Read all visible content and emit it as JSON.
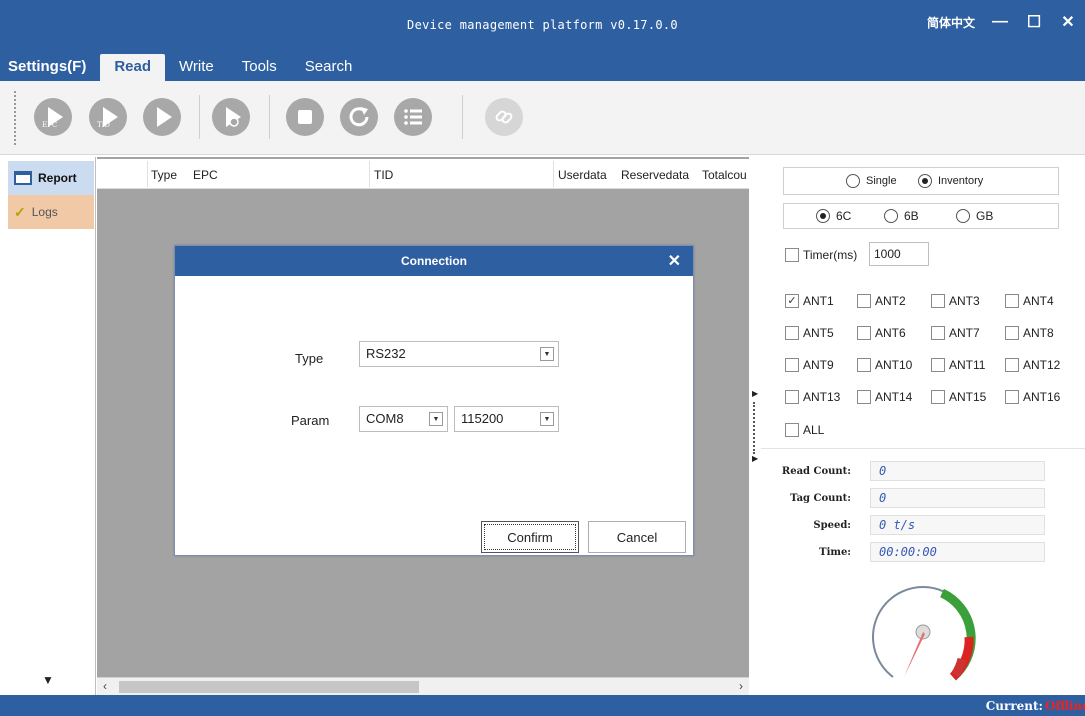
{
  "window": {
    "title": "Device management platform v0.17.0.0",
    "language": "简体中文",
    "minimize_icon": "minimize-icon",
    "maximize_icon": "maximize-icon",
    "close_icon": "close-icon"
  },
  "menu": {
    "tabs": [
      {
        "label": "Settings(F)"
      },
      {
        "label": "Read",
        "active": true
      },
      {
        "label": "Write"
      },
      {
        "label": "Tools"
      },
      {
        "label": "Search"
      }
    ]
  },
  "toolbar": {
    "buttons": [
      {
        "icon": "play-epc-icon",
        "sub": "EPC"
      },
      {
        "icon": "play-tid-icon",
        "sub": "TID"
      },
      {
        "icon": "play-icon"
      },
      {
        "icon": "play-data-icon"
      },
      {
        "icon": "stop-icon"
      },
      {
        "icon": "refresh-icon"
      },
      {
        "icon": "list-menu-icon"
      },
      {
        "icon": "link-icon"
      }
    ]
  },
  "sidebar": {
    "items": [
      {
        "label": "Report",
        "icon": "window-icon",
        "active": true
      },
      {
        "label": "Logs",
        "icon": "check-flag-icon"
      }
    ]
  },
  "table": {
    "columns": [
      "Type",
      "EPC",
      "TID",
      "Userdata",
      "Reservedata",
      "Totalcou"
    ]
  },
  "right_panel": {
    "mode_options": [
      {
        "label": "Single",
        "selected": false
      },
      {
        "label": "Inventory",
        "selected": true
      }
    ],
    "protocol_options": [
      {
        "label": "6C",
        "selected": true
      },
      {
        "label": "6B",
        "selected": false
      },
      {
        "label": "GB",
        "selected": false
      }
    ],
    "timer": {
      "label": "Timer(ms)",
      "checked": false,
      "value": "1000"
    },
    "antennas": [
      {
        "label": "ANT1",
        "checked": true
      },
      {
        "label": "ANT2",
        "checked": false
      },
      {
        "label": "ANT3",
        "checked": false
      },
      {
        "label": "ANT4",
        "checked": false
      },
      {
        "label": "ANT5",
        "checked": false
      },
      {
        "label": "ANT6",
        "checked": false
      },
      {
        "label": "ANT7",
        "checked": false
      },
      {
        "label": "ANT8",
        "checked": false
      },
      {
        "label": "ANT9",
        "checked": false
      },
      {
        "label": "ANT10",
        "checked": false
      },
      {
        "label": "ANT11",
        "checked": false
      },
      {
        "label": "ANT12",
        "checked": false
      },
      {
        "label": "ANT13",
        "checked": false
      },
      {
        "label": "ANT14",
        "checked": false
      },
      {
        "label": "ANT15",
        "checked": false
      },
      {
        "label": "ANT16",
        "checked": false
      }
    ],
    "all": {
      "label": "ALL",
      "checked": false
    },
    "stats": [
      {
        "label": "Read Count:",
        "value": "0"
      },
      {
        "label": "Tag Count:",
        "value": "0"
      },
      {
        "label": "Speed:",
        "value": "0  t/s"
      },
      {
        "label": "Time:",
        "value": "00:00:00"
      }
    ]
  },
  "status": {
    "current_label": "Current:",
    "current_value": "Offline",
    "current_color": "#e22222"
  },
  "dialog": {
    "title": "Connection",
    "type_label": "Type",
    "type_value": "RS232",
    "param_label": "Param",
    "port_value": "COM8",
    "baud_value": "115200",
    "confirm_label": "Confirm",
    "cancel_label": "Cancel"
  },
  "colors": {
    "accent": "#2e5fa1",
    "panel_bg": "#a3a3a3"
  }
}
